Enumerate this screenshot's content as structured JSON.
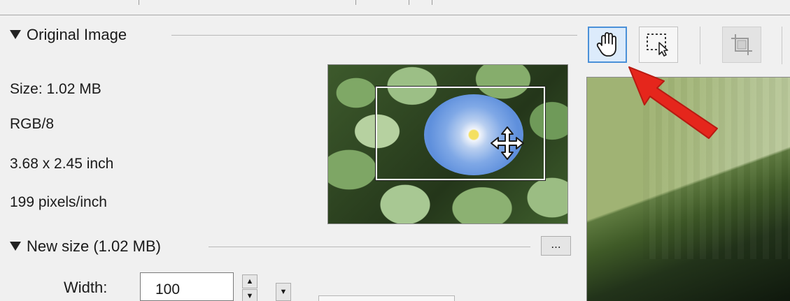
{
  "original_image": {
    "section_title": "Original Image",
    "size": "Size: 1.02 MB",
    "mode": "RGB/8",
    "dimensions": "3.68 x 2.45 inch",
    "resolution": "199 pixels/inch"
  },
  "new_size": {
    "section_title": "New size (1.02 MB)",
    "more_button_label": "...",
    "width_label": "Width:",
    "width_value": "100"
  },
  "toolbar": {
    "hand_tool": "hand-icon",
    "selection_tool": "marquee-select-icon",
    "crop_tool": "crop-icon"
  },
  "colors": {
    "active_tool_border": "#4a90d8",
    "annotation_arrow": "#e5261c"
  }
}
